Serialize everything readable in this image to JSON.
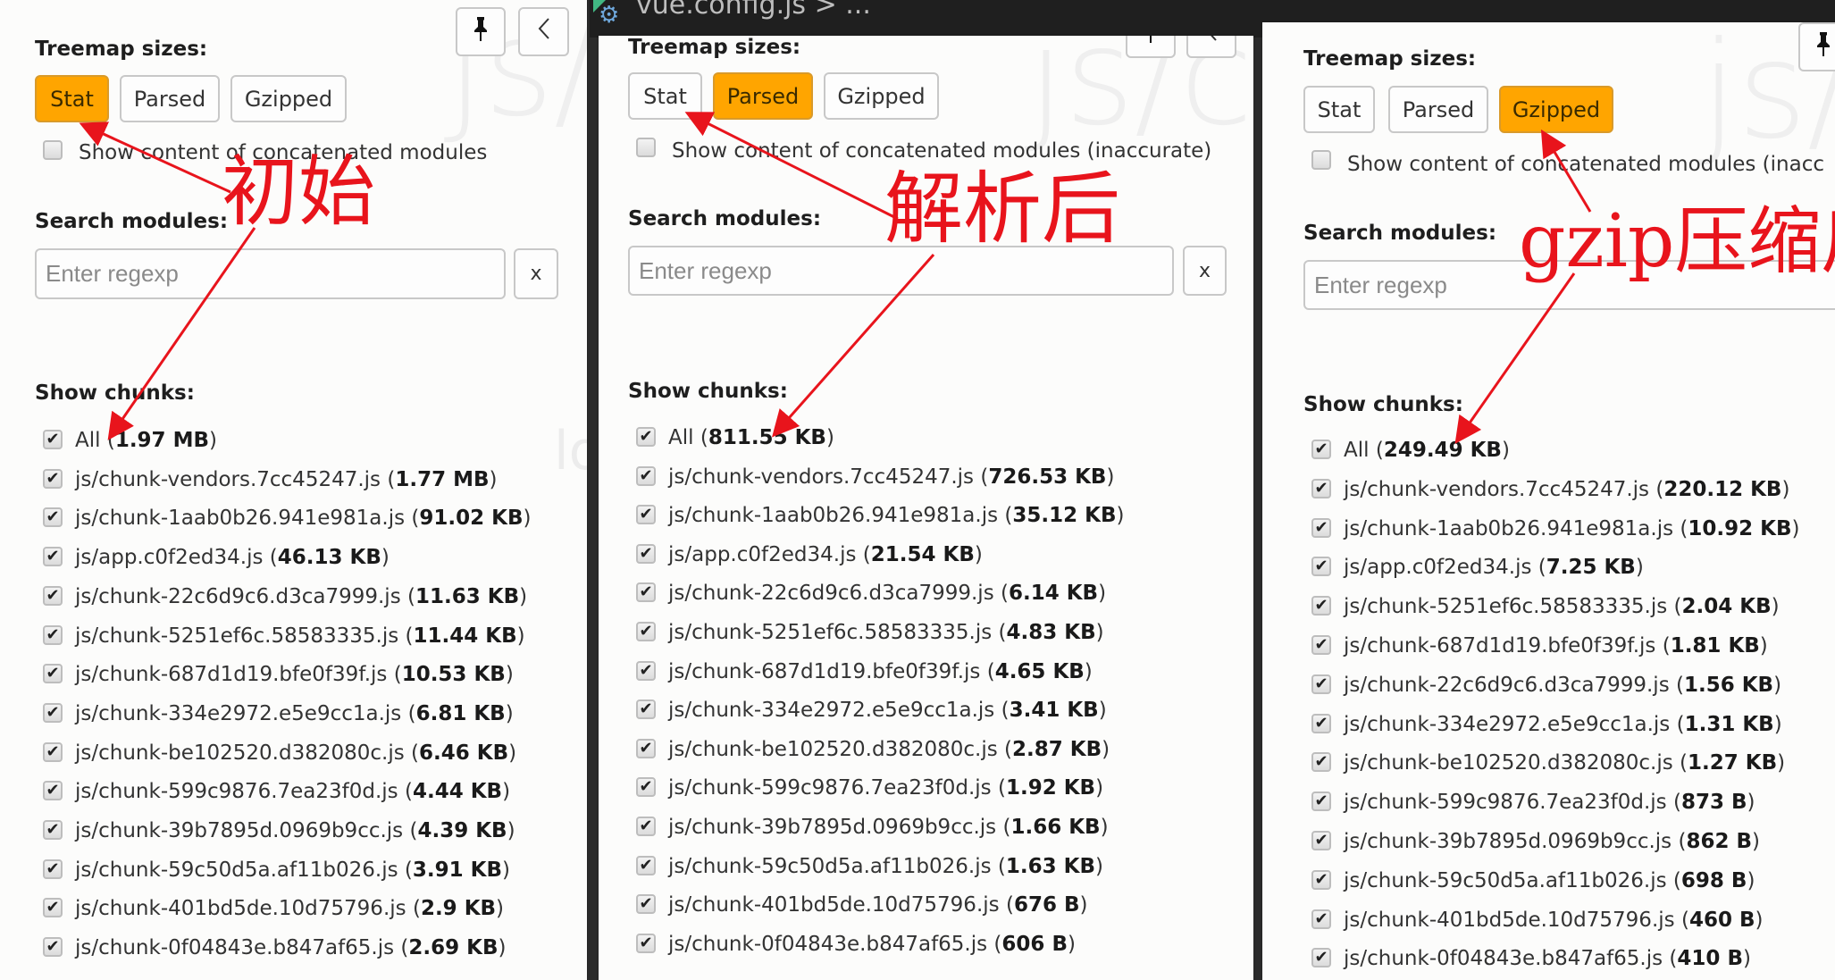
{
  "editor_tab": {
    "breadcrumb": "vue.config.js > ...",
    "icon": "gear-icon"
  },
  "panels": [
    {
      "id": "stat",
      "treemap_label": "Treemap sizes:",
      "size_buttons": [
        {
          "label": "Stat",
          "active": true
        },
        {
          "label": "Parsed",
          "active": false
        },
        {
          "label": "Gzipped",
          "active": false
        }
      ],
      "concat_checkbox": {
        "label": "Show content of concatenated modules",
        "checked": false
      },
      "search_label": "Search modules:",
      "search_placeholder": "Enter regexp",
      "search_value": "",
      "clear_label": "x",
      "chunks_label": "Show chunks:",
      "annotation": "初始",
      "chunks": [
        {
          "name": "All",
          "size": "1.97 MB",
          "checked": true
        },
        {
          "name": "js/chunk-vendors.7cc45247.js",
          "size": "1.77 MB",
          "checked": true
        },
        {
          "name": "js/chunk-1aab0b26.941e981a.js",
          "size": "91.02 KB",
          "checked": true
        },
        {
          "name": "js/app.c0f2ed34.js",
          "size": "46.13 KB",
          "checked": true
        },
        {
          "name": "js/chunk-22c6d9c6.d3ca7999.js",
          "size": "11.63 KB",
          "checked": true
        },
        {
          "name": "js/chunk-5251ef6c.58583335.js",
          "size": "11.44 KB",
          "checked": true
        },
        {
          "name": "js/chunk-687d1d19.bfe0f39f.js",
          "size": "10.53 KB",
          "checked": true
        },
        {
          "name": "js/chunk-334e2972.e5e9cc1a.js",
          "size": "6.81 KB",
          "checked": true
        },
        {
          "name": "js/chunk-be102520.d382080c.js",
          "size": "6.46 KB",
          "checked": true
        },
        {
          "name": "js/chunk-599c9876.7ea23f0d.js",
          "size": "4.44 KB",
          "checked": true
        },
        {
          "name": "js/chunk-39b7895d.0969b9cc.js",
          "size": "4.39 KB",
          "checked": true
        },
        {
          "name": "js/chunk-59c50d5a.af11b026.js",
          "size": "3.91 KB",
          "checked": true
        },
        {
          "name": "js/chunk-401bd5de.10d75796.js",
          "size": "2.9 KB",
          "checked": true
        },
        {
          "name": "js/chunk-0f04843e.b847af65.js",
          "size": "2.69 KB",
          "checked": true
        }
      ]
    },
    {
      "id": "parsed",
      "treemap_label": "Treemap sizes:",
      "size_buttons": [
        {
          "label": "Stat",
          "active": false
        },
        {
          "label": "Parsed",
          "active": true
        },
        {
          "label": "Gzipped",
          "active": false
        }
      ],
      "concat_checkbox": {
        "label": "Show content of concatenated modules (inaccurate)",
        "checked": false
      },
      "search_label": "Search modules:",
      "search_placeholder": "Enter regexp",
      "search_value": "",
      "clear_label": "x",
      "chunks_label": "Show chunks:",
      "annotation": "解析后",
      "chunks": [
        {
          "name": "All",
          "size": "811.55 KB",
          "checked": true
        },
        {
          "name": "js/chunk-vendors.7cc45247.js",
          "size": "726.53 KB",
          "checked": true
        },
        {
          "name": "js/chunk-1aab0b26.941e981a.js",
          "size": "35.12 KB",
          "checked": true
        },
        {
          "name": "js/app.c0f2ed34.js",
          "size": "21.54 KB",
          "checked": true
        },
        {
          "name": "js/chunk-22c6d9c6.d3ca7999.js",
          "size": "6.14 KB",
          "checked": true
        },
        {
          "name": "js/chunk-5251ef6c.58583335.js",
          "size": "4.83 KB",
          "checked": true
        },
        {
          "name": "js/chunk-687d1d19.bfe0f39f.js",
          "size": "4.65 KB",
          "checked": true
        },
        {
          "name": "js/chunk-334e2972.e5e9cc1a.js",
          "size": "3.41 KB",
          "checked": true
        },
        {
          "name": "js/chunk-be102520.d382080c.js",
          "size": "2.87 KB",
          "checked": true
        },
        {
          "name": "js/chunk-599c9876.7ea23f0d.js",
          "size": "1.92 KB",
          "checked": true
        },
        {
          "name": "js/chunk-39b7895d.0969b9cc.js",
          "size": "1.66 KB",
          "checked": true
        },
        {
          "name": "js/chunk-59c50d5a.af11b026.js",
          "size": "1.63 KB",
          "checked": true
        },
        {
          "name": "js/chunk-401bd5de.10d75796.js",
          "size": "676 B",
          "checked": true
        },
        {
          "name": "js/chunk-0f04843e.b847af65.js",
          "size": "606 B",
          "checked": true
        }
      ]
    },
    {
      "id": "gzipped",
      "treemap_label": "Treemap sizes:",
      "size_buttons": [
        {
          "label": "Stat",
          "active": false
        },
        {
          "label": "Parsed",
          "active": false
        },
        {
          "label": "Gzipped",
          "active": true
        }
      ],
      "concat_checkbox": {
        "label": "Show content of concatenated modules (inacc",
        "checked": false
      },
      "search_label": "Search modules:",
      "search_placeholder": "Enter regexp",
      "search_value": "",
      "clear_label": "x",
      "chunks_label": "Show chunks:",
      "annotation": "gzip压缩后",
      "chunks": [
        {
          "name": "All",
          "size": "249.49 KB",
          "checked": true
        },
        {
          "name": "js/chunk-vendors.7cc45247.js",
          "size": "220.12 KB",
          "checked": true
        },
        {
          "name": "js/chunk-1aab0b26.941e981a.js",
          "size": "10.92 KB",
          "checked": true
        },
        {
          "name": "js/app.c0f2ed34.js",
          "size": "7.25 KB",
          "checked": true
        },
        {
          "name": "js/chunk-5251ef6c.58583335.js",
          "size": "2.04 KB",
          "checked": true
        },
        {
          "name": "js/chunk-687d1d19.bfe0f39f.js",
          "size": "1.81 KB",
          "checked": true
        },
        {
          "name": "js/chunk-22c6d9c6.d3ca7999.js",
          "size": "1.56 KB",
          "checked": true
        },
        {
          "name": "js/chunk-334e2972.e5e9cc1a.js",
          "size": "1.31 KB",
          "checked": true
        },
        {
          "name": "js/chunk-be102520.d382080c.js",
          "size": "1.27 KB",
          "checked": true
        },
        {
          "name": "js/chunk-599c9876.7ea23f0d.js",
          "size": "873 B",
          "checked": true
        },
        {
          "name": "js/chunk-39b7895d.0969b9cc.js",
          "size": "862 B",
          "checked": true
        },
        {
          "name": "js/chunk-59c50d5a.af11b026.js",
          "size": "698 B",
          "checked": true
        },
        {
          "name": "js/chunk-401bd5de.10d75796.js",
          "size": "460 B",
          "checked": true
        },
        {
          "name": "js/chunk-0f04843e.b847af65.js",
          "size": "410 B",
          "checked": true
        }
      ]
    }
  ],
  "icons": {
    "pin": "pin-icon",
    "collapse": "chevron-left-icon",
    "checkmark": "✔"
  },
  "watermark": "js/c",
  "colors": {
    "active_button": "#ffa500",
    "annotation": "#e8141c",
    "panel_bg": "#fcfcfb"
  }
}
